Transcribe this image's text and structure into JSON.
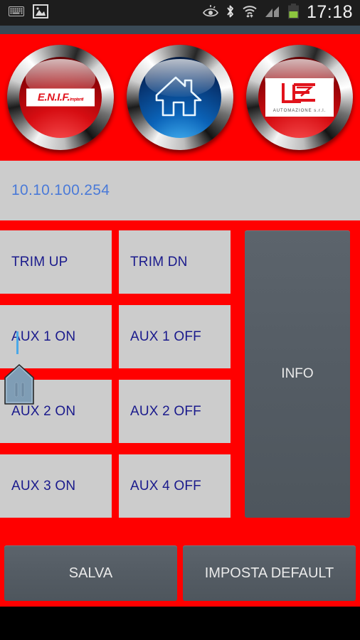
{
  "statusbar": {
    "icons_left": [
      "keyboard-icon",
      "screenshot-image-icon"
    ],
    "icons_right": [
      "smart-stay-eye-icon",
      "bluetooth-icon",
      "wifi-icon",
      "signal-bars-icon",
      "battery-icon"
    ],
    "clock": "17:18"
  },
  "header": {
    "logos": [
      {
        "name": "enif-impianti-logo",
        "brand": "E.N.I.F.",
        "suffix": "impianti"
      },
      {
        "name": "home-button",
        "label": "home"
      },
      {
        "name": "lc-automazione-logo",
        "brand": "LC",
        "suffix": "AUTOMAZIONE s.r.l."
      }
    ]
  },
  "address": {
    "value": "10.10.100.254",
    "placeholder": "10.10.100.254"
  },
  "controls": {
    "buttons": [
      {
        "label": "TRIM UP"
      },
      {
        "label": "TRIM DN"
      },
      {
        "label": "AUX 1 ON"
      },
      {
        "label": "AUX 1 OFF"
      },
      {
        "label": "AUX 2 ON"
      },
      {
        "label": "AUX 2 OFF"
      },
      {
        "label": "AUX 3 ON"
      },
      {
        "label": "AUX 4 OFF"
      }
    ],
    "info_label": "INFO"
  },
  "footer": {
    "save_label": "SALVA",
    "default_label": "IMPOSTA DEFAULT"
  },
  "colors": {
    "background_red": "#ff0000",
    "button_gray": "#cccccc",
    "button_text_navy": "#1a1a8c",
    "panel_dark": "#545c64",
    "ip_text_blue": "#4a7ad8",
    "statusbar_black": "#1d1d1d",
    "statusbar_accent": "#3a4a56",
    "caret_blue": "#4aa8e8"
  }
}
